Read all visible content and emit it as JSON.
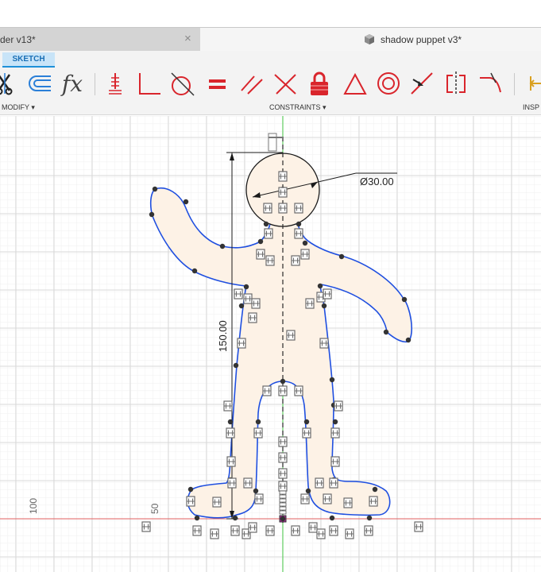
{
  "tabs": {
    "inactive_label": "der v13*",
    "close_glyph": "×",
    "active_label": "shadow puppet v3*"
  },
  "toolbar": {
    "sketch_tab": "SKETCH",
    "modify_label": "MODIFY ▾",
    "constraints_label": "CONSTRAINTS ▾",
    "inspect_label": "INSP",
    "fx_label": "fx"
  },
  "canvas": {
    "diameter_label": "Ø30.00",
    "height_label": "150.00",
    "axis_label_100": "100",
    "axis_label_50": "50"
  },
  "colors": {
    "accent": "#1e90d8",
    "sketch_line": "#1f4fe0",
    "profile_fill": "#fdf2e6",
    "constraint_red": "#d9252c",
    "axis_green": "#45c845",
    "axis_red": "#e06060"
  },
  "icons": [
    "trim-icon",
    "offset-icon",
    "fx-icon",
    "coincident-icon",
    "perpendicular-icon",
    "tangent-icon",
    "equal-icon",
    "parallel-icon",
    "collinear-icon",
    "fix-lock-icon",
    "triangle-icon",
    "concentric-icon",
    "midpoint-icon",
    "symmetry-icon",
    "curvature-icon",
    "measure-icon",
    "doc-icon",
    "origin-icon"
  ]
}
